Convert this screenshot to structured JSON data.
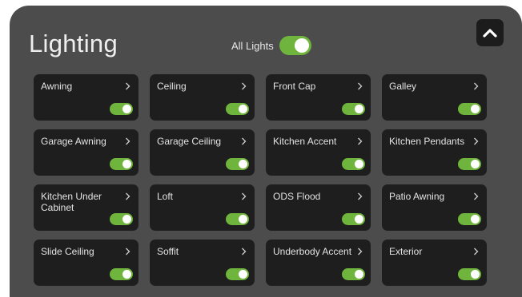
{
  "header": {
    "title": "Lighting",
    "all_lights_label": "All Lights",
    "all_lights_on": true,
    "collapse_icon": "chevron-up-icon"
  },
  "colors": {
    "panel_bg": "#4b4c4b",
    "card_bg": "#1e1e1e",
    "toggle_on": "#6fb43c"
  },
  "lights": [
    {
      "label": "Awning",
      "on": true
    },
    {
      "label": "Ceiling",
      "on": true
    },
    {
      "label": "Front Cap",
      "on": true
    },
    {
      "label": "Galley",
      "on": true
    },
    {
      "label": "Garage Awning",
      "on": true
    },
    {
      "label": "Garage Ceiling",
      "on": true
    },
    {
      "label": "Kitchen Accent",
      "on": true
    },
    {
      "label": "Kitchen Pendants",
      "on": true
    },
    {
      "label": "Kitchen Under Cabinet",
      "on": true
    },
    {
      "label": "Loft",
      "on": true
    },
    {
      "label": "ODS Flood",
      "on": true
    },
    {
      "label": "Patio Awning",
      "on": true
    },
    {
      "label": "Slide Ceiling",
      "on": true
    },
    {
      "label": "Soffit",
      "on": true
    },
    {
      "label": "Underbody Accent",
      "on": true
    },
    {
      "label": "Exterior",
      "on": true
    }
  ]
}
